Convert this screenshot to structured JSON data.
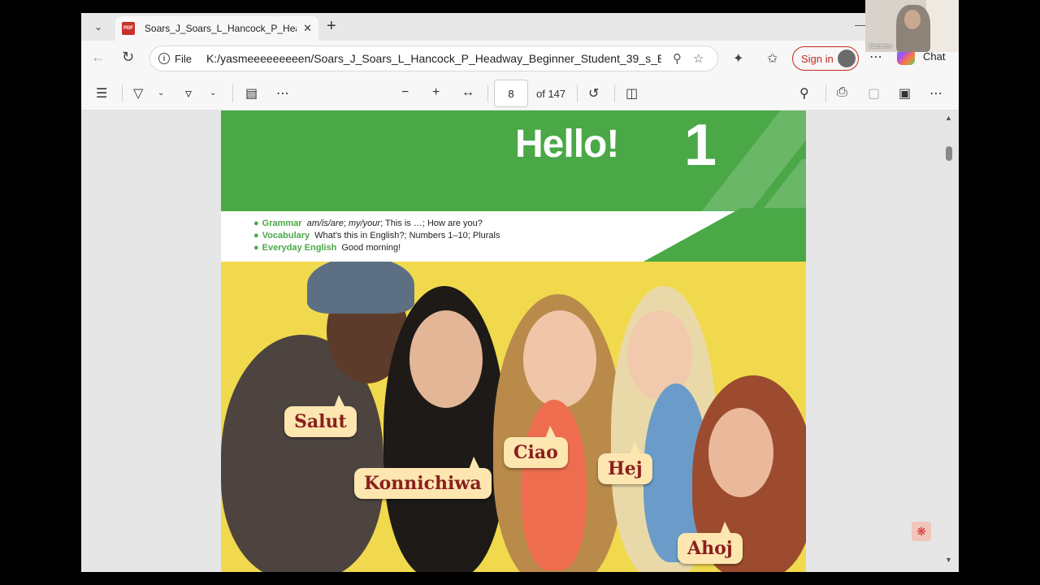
{
  "tab": {
    "title": "Soars_J_Soars_L_Hancock_P_Headway_Beginner_Student",
    "favicon": "PDF"
  },
  "address": {
    "protocol_label": "File",
    "url": "K:/yasmeeeeeeeeen/Soars_J_Soars_L_Hancock_P_Headway_Beginner_Student_39_s_B..."
  },
  "account": {
    "signin_label": "Sign in",
    "chat_label": "Chat"
  },
  "pdf_toolbar": {
    "page_current": "8",
    "page_total_label": "of 147"
  },
  "page": {
    "heading": "Hello!",
    "unit_number": "1",
    "topics": [
      {
        "label": "Grammar",
        "parts": [
          {
            "text": "am/is/are",
            "italic": true
          },
          {
            "text": "; ",
            "italic": false
          },
          {
            "text": "my/your",
            "italic": true
          },
          {
            "text": "; This is …; How are you?",
            "italic": false
          }
        ]
      },
      {
        "label": "Vocabulary",
        "parts": [
          {
            "text": "What's this in English?; Numbers 1–10; Plurals",
            "italic": false
          }
        ]
      },
      {
        "label": "Everyday English",
        "parts": [
          {
            "text": "Good morning!",
            "italic": false
          }
        ]
      }
    ],
    "greetings": [
      "Salut",
      "Konnichiwa",
      "Ciao",
      "Hej",
      "Ahoj"
    ]
  },
  "webcam": {
    "name": "Yasmeen"
  },
  "colors": {
    "unit_green": "#4aa847",
    "bubble": "#fde6b0",
    "bubble_text": "#8a1f1f",
    "photo_bg": "#f1d94e",
    "signin_red": "#c42b1c"
  }
}
